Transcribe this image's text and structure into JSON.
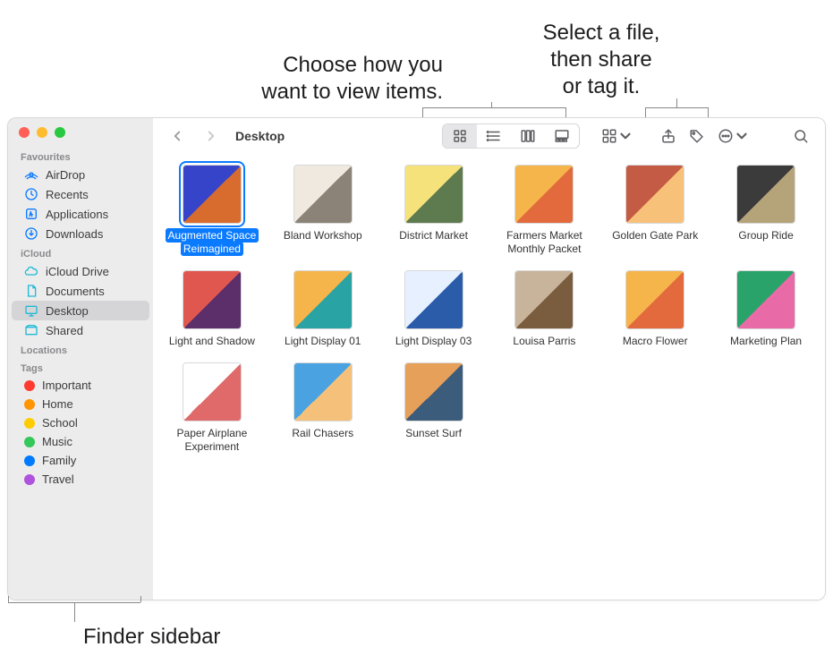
{
  "callouts": {
    "view": "Choose how you\nwant to view items.",
    "share": "Select a file,\nthen share\nor tag it.",
    "sidebar": "Finder sidebar"
  },
  "window": {
    "title": "Desktop"
  },
  "traffic": {
    "close": "#ff5f57",
    "min": "#febc2e",
    "max": "#28c840"
  },
  "sidebar": {
    "sections": [
      {
        "header": "Favourites",
        "items": [
          {
            "icon": "airdrop-icon",
            "label": "AirDrop"
          },
          {
            "icon": "recents-icon",
            "label": "Recents"
          },
          {
            "icon": "applications-icon",
            "label": "Applications"
          },
          {
            "icon": "downloads-icon",
            "label": "Downloads"
          }
        ]
      },
      {
        "header": "iCloud",
        "items": [
          {
            "icon": "icloud-icon",
            "label": "iCloud Drive"
          },
          {
            "icon": "documents-icon",
            "label": "Documents"
          },
          {
            "icon": "desktop-icon",
            "label": "Desktop",
            "selected": true
          },
          {
            "icon": "shared-icon",
            "label": "Shared"
          }
        ]
      },
      {
        "header": "Locations",
        "items": []
      }
    ],
    "tags_header": "Tags",
    "tags": [
      {
        "color": "#ff3b30",
        "label": "Important"
      },
      {
        "color": "#ff9500",
        "label": "Home"
      },
      {
        "color": "#ffcc00",
        "label": "School"
      },
      {
        "color": "#34c759",
        "label": "Music"
      },
      {
        "color": "#007aff",
        "label": "Family"
      },
      {
        "color": "#af52de",
        "label": "Travel"
      }
    ]
  },
  "toolbar": {
    "back": "Back",
    "forward": "Forward",
    "views": [
      "icon-view",
      "list-view",
      "column-view",
      "gallery-view"
    ],
    "active_view": "icon-view",
    "group": "Group",
    "share": "Share",
    "tag": "Tag",
    "more": "More",
    "search": "Search"
  },
  "files": [
    {
      "label": "Augmented Space Reimagined",
      "selected": true,
      "colors": [
        "#3544c9",
        "#d86b2e"
      ]
    },
    {
      "label": "Bland Workshop",
      "colors": [
        "#efe9e0",
        "#8b8377"
      ]
    },
    {
      "label": "District Market",
      "colors": [
        "#f6e27a",
        "#5e7b4f"
      ]
    },
    {
      "label": "Farmers Market Monthly Packet",
      "colors": [
        "#f5b54a",
        "#e26a3d"
      ]
    },
    {
      "label": "Golden Gate Park",
      "colors": [
        "#c45b44",
        "#f7c17a"
      ]
    },
    {
      "label": "Group Ride",
      "colors": [
        "#3b3b3b",
        "#b5a37a"
      ]
    },
    {
      "label": "Light and Shadow",
      "colors": [
        "#e0574f",
        "#5c2e6a"
      ]
    },
    {
      "label": "Light Display 01",
      "colors": [
        "#f5b54a",
        "#29a3a3"
      ]
    },
    {
      "label": "Light Display 03",
      "colors": [
        "#e6f0ff",
        "#2a5caa"
      ]
    },
    {
      "label": "Louisa Parris",
      "colors": [
        "#c7b49a",
        "#7a5c3e"
      ]
    },
    {
      "label": "Macro Flower",
      "colors": [
        "#f5b54a",
        "#e26a3d"
      ]
    },
    {
      "label": "Marketing Plan",
      "colors": [
        "#2aa36a",
        "#e86aa6"
      ]
    },
    {
      "label": "Paper Airplane Experiment",
      "colors": [
        "#ffffff",
        "#e06a6a"
      ]
    },
    {
      "label": "Rail Chasers",
      "colors": [
        "#4aa3e0",
        "#f5c17a"
      ]
    },
    {
      "label": "Sunset Surf",
      "colors": [
        "#e6a05a",
        "#3b5c7a"
      ]
    }
  ]
}
